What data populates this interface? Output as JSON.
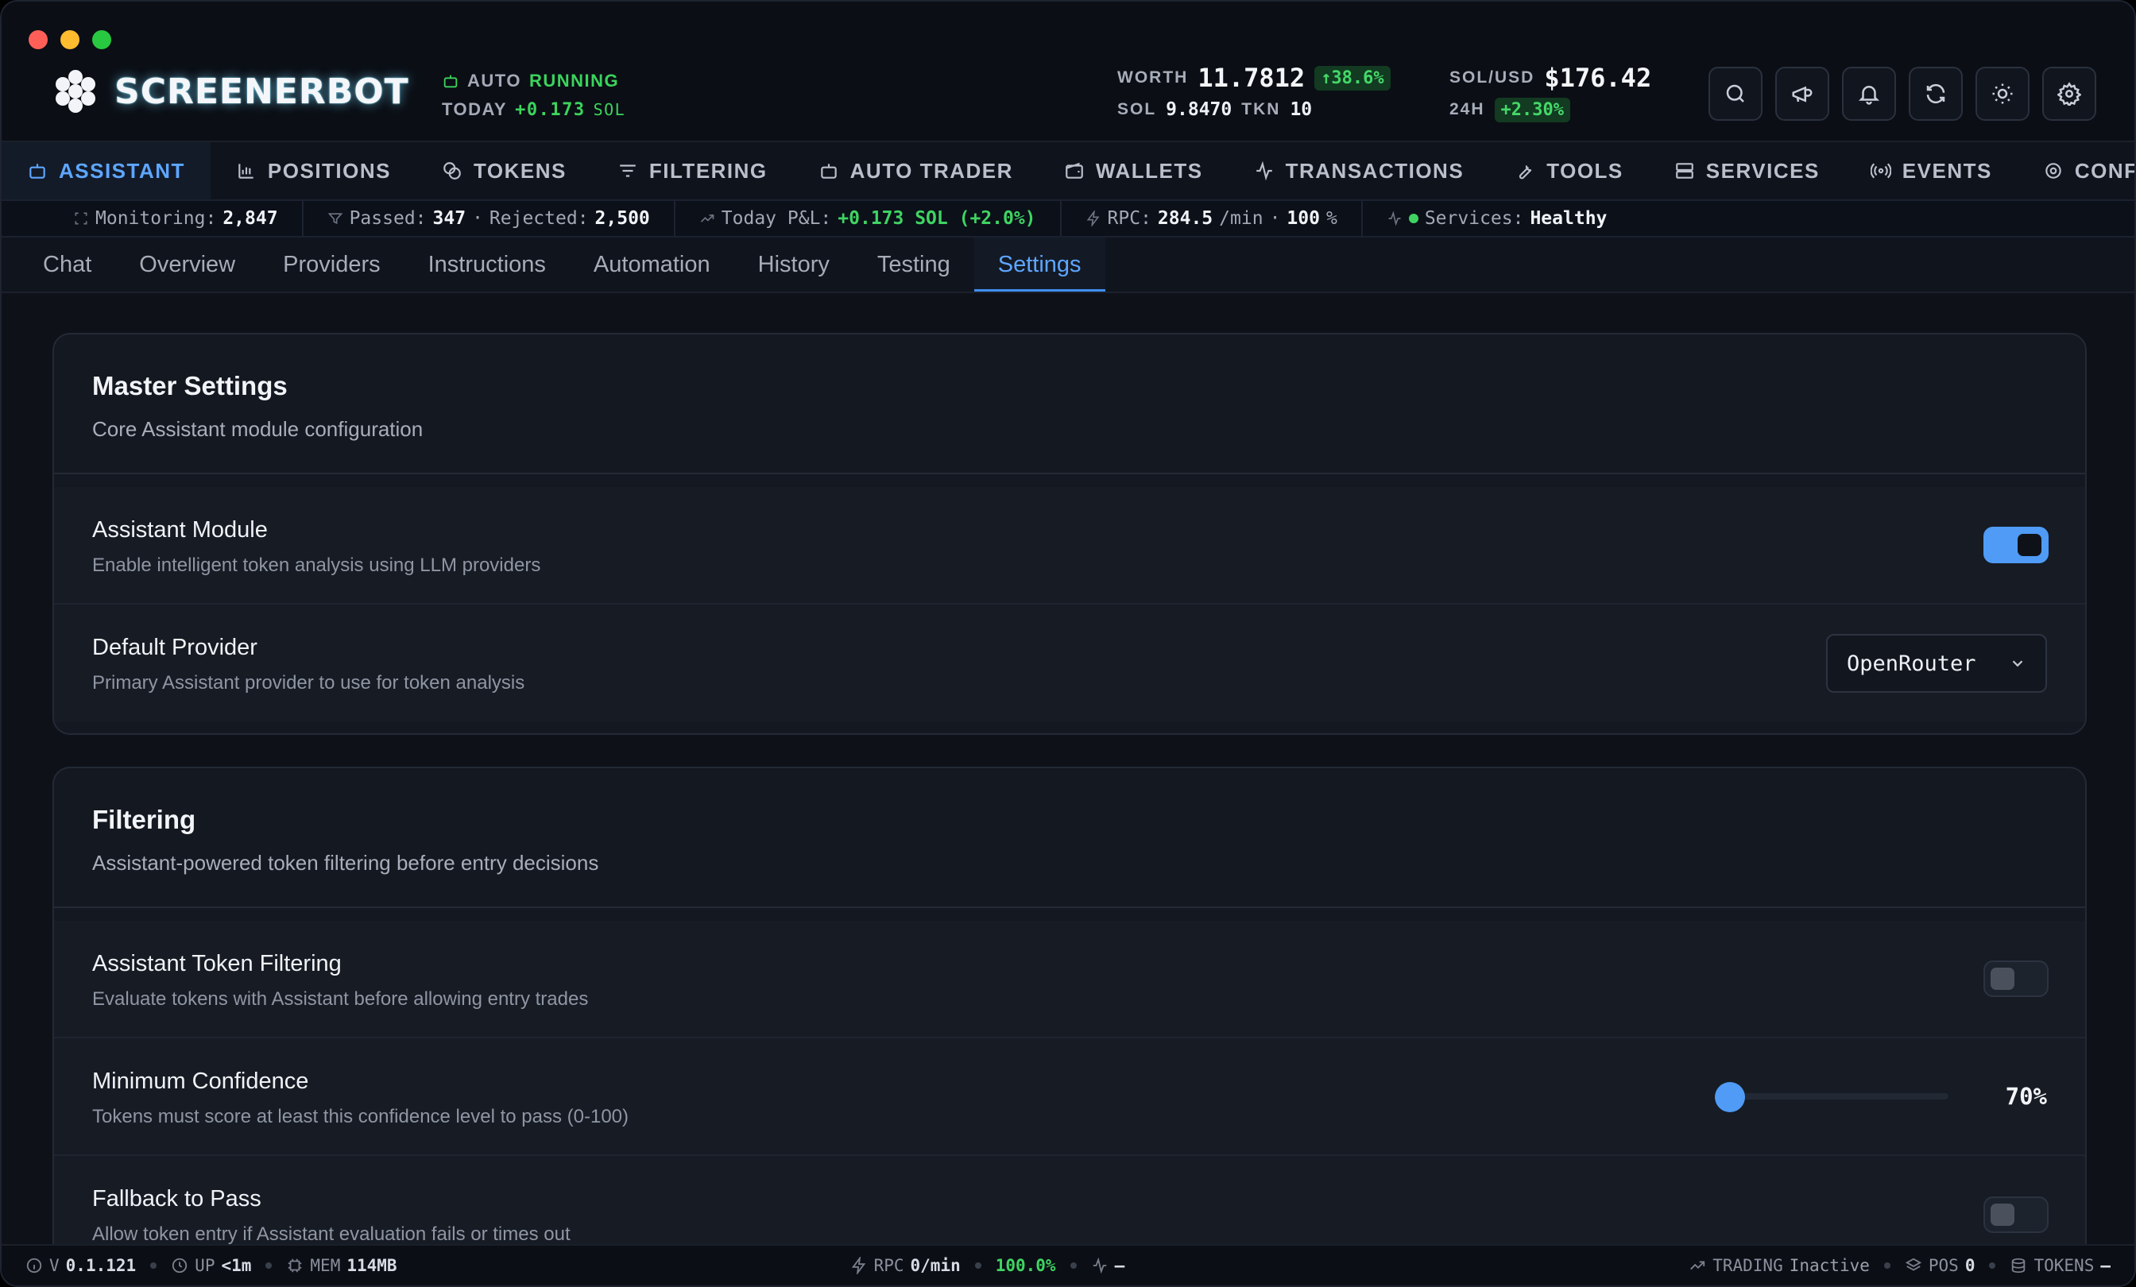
{
  "header": {
    "brand": "SCREENERBOT",
    "auto_label": "AUTO",
    "auto_status": "RUNNING",
    "today_label": "TODAY",
    "today_value": "+0.173",
    "today_unit": "SOL",
    "worth_label": "WORTH",
    "worth_value": "11.7812",
    "worth_change": "↑38.6%",
    "sol_label": "SOL",
    "sol_value": "9.8470",
    "tkn_label": "TKN",
    "tkn_value": "10",
    "solusd_label": "SOL/USD",
    "solusd_value": "$176.42",
    "h24_label": "24H",
    "h24_change": "+2.30%"
  },
  "nav": {
    "items": [
      {
        "label": "ASSISTANT",
        "icon": "robot-icon"
      },
      {
        "label": "POSITIONS",
        "icon": "chart-icon"
      },
      {
        "label": "TOKENS",
        "icon": "coins-icon"
      },
      {
        "label": "FILTERING",
        "icon": "filter-icon"
      },
      {
        "label": "AUTO TRADER",
        "icon": "bot-icon"
      },
      {
        "label": "WALLETS",
        "icon": "wallet-icon"
      },
      {
        "label": "TRANSACTIONS",
        "icon": "activity-icon"
      },
      {
        "label": "TOOLS",
        "icon": "wrench-icon"
      },
      {
        "label": "SERVICES",
        "icon": "server-icon"
      },
      {
        "label": "EVENTS",
        "icon": "radio-icon"
      },
      {
        "label": "CONFIG",
        "icon": "gear-icon"
      }
    ]
  },
  "strip": {
    "monitoring_label": "Monitoring:",
    "monitoring_value": "2,847",
    "passed_label": "Passed:",
    "passed_value": "347",
    "sep": "·",
    "rejected_label": "Rejected:",
    "rejected_value": "2,500",
    "pnl_label": "Today P&L:",
    "pnl_value": "+0.173 SOL (+2.0%)",
    "rpc_label": "RPC:",
    "rpc_value": "284.5",
    "rpc_unit": "/min",
    "rpc_pct": "100",
    "rpc_pct_unit": "%",
    "services_label": "Services:",
    "services_value": "Healthy"
  },
  "subtabs": [
    "Chat",
    "Overview",
    "Providers",
    "Instructions",
    "Automation",
    "History",
    "Testing",
    "Settings"
  ],
  "master": {
    "title": "Master Settings",
    "subtitle": "Core Assistant module configuration",
    "module_title": "Assistant Module",
    "module_desc": "Enable intelligent token analysis using LLM providers",
    "module_enabled": true,
    "provider_title": "Default Provider",
    "provider_desc": "Primary Assistant provider to use for token analysis",
    "provider_value": "OpenRouter"
  },
  "filtering": {
    "title": "Filtering",
    "subtitle": "Assistant-powered token filtering before entry decisions",
    "token_filter_title": "Assistant Token Filtering",
    "token_filter_desc": "Evaluate tokens with Assistant before allowing entry trades",
    "token_filter_enabled": false,
    "confidence_title": "Minimum Confidence",
    "confidence_desc": "Tokens must score at least this confidence level to pass (0-100)",
    "confidence_value": "70%",
    "fallback_title": "Fallback to Pass",
    "fallback_desc": "Allow token entry if Assistant evaluation fails or times out",
    "fallback_enabled": false
  },
  "footer": {
    "version_label": "V",
    "version_value": "0.1.121",
    "up_label": "UP",
    "up_value": "<1m",
    "mem_label": "MEM",
    "mem_value": "114MB",
    "rpc_label": "RPC",
    "rpc_value": "0/min",
    "rpc_pct": "100.0%",
    "pulse_value": "–",
    "trading_label": "TRADING",
    "trading_value": "Inactive",
    "pos_label": "POS",
    "pos_value": "0",
    "tokens_label": "TOKENS",
    "tokens_value": "–"
  },
  "colors": {
    "accent": "#5ea6ff",
    "positive": "#3fd462",
    "background": "#0e1118",
    "card": "#141820"
  }
}
